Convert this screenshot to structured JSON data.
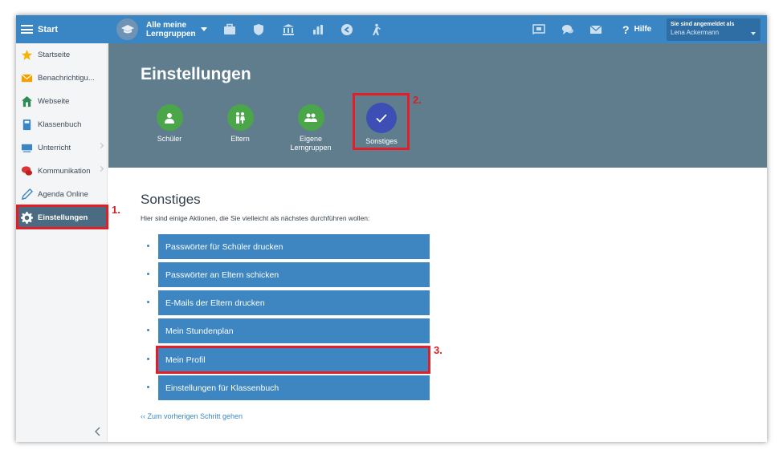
{
  "topbar": {
    "menu_label": "Start",
    "group_selector": "Alle meine Lerngruppen",
    "help_label": "Hilfe",
    "login_label": "Sie sind angemeldet als",
    "login_user": "Lena Ackermann",
    "icons": [
      "briefcase-icon",
      "shield-icon",
      "bank-icon",
      "chart-icon",
      "back-arrow-icon",
      "hiking-icon"
    ],
    "right_icons": [
      "cast-icon",
      "chat-icon",
      "mail-icon"
    ]
  },
  "sidebar": {
    "items": [
      {
        "label": "Startseite",
        "icon": "star-icon",
        "color": "#f4b400"
      },
      {
        "label": "Benachrichtigu...",
        "icon": "envelope-icon",
        "color": "#f4a000"
      },
      {
        "label": "Webseite",
        "icon": "home-icon",
        "color": "#2e8b57"
      },
      {
        "label": "Klassenbuch",
        "icon": "book-icon",
        "color": "#3a86c4"
      },
      {
        "label": "Unterricht",
        "icon": "class-icon",
        "color": "#3a86c4"
      },
      {
        "label": "Kommunikation",
        "icon": "chat-icon",
        "color": "#d33"
      },
      {
        "label": "Agenda Online",
        "icon": "pen-icon",
        "color": "#3a86c4"
      },
      {
        "label": "Einstellungen",
        "icon": "gear-icon",
        "color": "#ffffff"
      }
    ]
  },
  "header": {
    "title": "Einstellungen",
    "tiles": [
      {
        "label": "Schüler",
        "icon": "person-icon"
      },
      {
        "label": "Eltern",
        "icon": "parents-icon"
      },
      {
        "label": "Eigene Lerngruppen",
        "icon": "group-icon"
      },
      {
        "label": "Sonstiges",
        "icon": "check-icon"
      }
    ]
  },
  "content": {
    "title": "Sonstiges",
    "subtitle": "Hier sind einige Aktionen, die Sie vielleicht als nächstes durchführen wollen:",
    "actions": [
      "Passwörter für Schüler drucken",
      "Passwörter an Eltern schicken",
      "E-Mails der Eltern drucken",
      "Mein Stundenplan",
      "Mein Profil",
      "Einstellungen für Klassenbuch"
    ],
    "back_link": "‹‹ Zum vorherigen Schritt gehen"
  },
  "annotations": {
    "step1": "1.",
    "step2": "2.",
    "step3": "3.",
    "color": "#e41e26"
  }
}
